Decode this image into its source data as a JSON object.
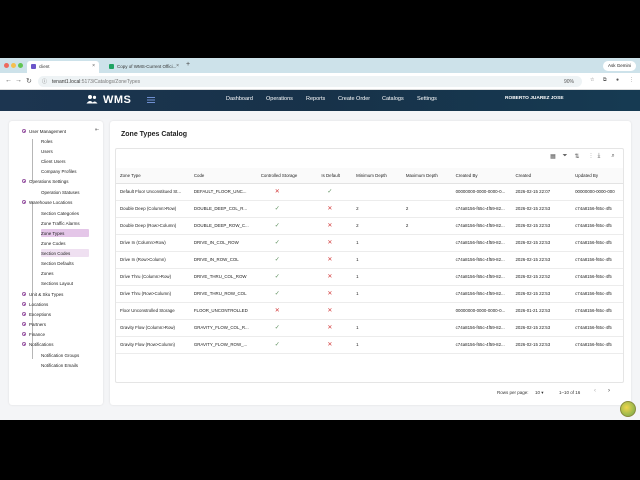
{
  "browser": {
    "tabs": [
      {
        "title": "client",
        "active": true
      },
      {
        "title": "Copy of WMS-Current Offici...",
        "active": false
      }
    ],
    "ask_button": "Ask Gemini",
    "url_host": "tenant1.local",
    "url_path": ":5173/Catalogs/ZoneTypes",
    "zoom": "90%"
  },
  "app": {
    "logo": "WMS",
    "nav": [
      "Dashboard",
      "Operations",
      "Reports",
      "Create Order",
      "Catalogs",
      "Settings"
    ],
    "user": "ROBERTO JUAREZ JOSE"
  },
  "sidebar": {
    "items": [
      {
        "label": "User Management",
        "level": 0
      },
      {
        "label": "Roles",
        "level": 1
      },
      {
        "label": "Users",
        "level": 1
      },
      {
        "label": "Client Users",
        "level": 1
      },
      {
        "label": "Company Profiles",
        "level": 1
      },
      {
        "label": "Operations Settings",
        "level": 0
      },
      {
        "label": "Operation Statuses",
        "level": 1
      },
      {
        "label": "Warehouse Locations",
        "level": 0
      },
      {
        "label": "Section Categories",
        "level": 1
      },
      {
        "label": "Zone Traffic Alarms",
        "level": 1
      },
      {
        "label": "Zone Types",
        "level": 1
      },
      {
        "label": "Zone Codes",
        "level": 1
      },
      {
        "label": "Section Codes",
        "level": 1
      },
      {
        "label": "Section Defaults",
        "level": 1
      },
      {
        "label": "Zones",
        "level": 1
      },
      {
        "label": "Sections Layout",
        "level": 1
      },
      {
        "label": "Unit & Sku Types",
        "level": 0
      },
      {
        "label": "Locations",
        "level": 0
      },
      {
        "label": "Exceptions",
        "level": 0
      },
      {
        "label": "Partners",
        "level": 0
      },
      {
        "label": "Finance",
        "level": 0
      },
      {
        "label": "Notifications",
        "level": 0
      },
      {
        "label": "Notification Groups",
        "level": 1
      },
      {
        "label": "Notification Emails",
        "level": 1
      }
    ]
  },
  "main": {
    "title": "Zone Types Catalog",
    "columns": [
      "Zone Type",
      "Code",
      "Controlled Storage",
      "Is Default",
      "Minimum Depth",
      "Maximum Depth",
      "Created By",
      "Created",
      "Updated By"
    ],
    "rows": [
      [
        "Default Floor Unconstitued St...",
        "DEFAULT_FLOOR_UNC...",
        "no",
        "yes",
        "",
        "",
        "00000000-0000-0000-0...",
        "2026-02-15 22:07",
        "00000000-0000-000"
      ],
      [
        "Double Deep (Column>Row)",
        "DOUBLE_DEEP_COL_R...",
        "yes",
        "no",
        "2",
        "2",
        "c74a8156-f65c-4f59-82...",
        "2026-02-15 22:53",
        "c74a8156-f65c-4f5"
      ],
      [
        "Double Deep (Row>Column)",
        "DOUBLE_DEEP_ROW_C...",
        "yes",
        "no",
        "2",
        "2",
        "c74a8156-f65c-4f59-82...",
        "2026-02-15 22:53",
        "c74a8156-f65c-4f5"
      ],
      [
        "Drive In (Column>Row)",
        "DRIVE_IN_COL_ROW",
        "yes",
        "no",
        "1",
        "",
        "c74a8156-f65c-4f59-82...",
        "2026-02-15 22:53",
        "c74a8156-f65c-4f5"
      ],
      [
        "Drive In (Row>Column)",
        "DRIVE_IN_ROW_COL",
        "yes",
        "no",
        "1",
        "",
        "c74a8156-f65c-4f59-82...",
        "2026-02-15 22:53",
        "c74a8156-f65c-4f5"
      ],
      [
        "Drive Thru (Column>Row)",
        "DRIVE_THRU_COL_ROW",
        "yes",
        "no",
        "1",
        "",
        "c74a8156-f65c-4f59-82...",
        "2026-02-15 22:52",
        "c74a8156-f65c-4f5"
      ],
      [
        "Drive Thru (Row>Column)",
        "DRIVE_THRU_ROW_COL",
        "yes",
        "no",
        "1",
        "",
        "c74a8156-f65c-4f59-82...",
        "2026-02-15 22:53",
        "c74a8156-f65c-4f5"
      ],
      [
        "Floor Unconstrolled Storage",
        "FLOOR_UNCONTROLLED",
        "no",
        "no",
        "",
        "",
        "00000000-0000-0000-0...",
        "2026-01-21 22:53",
        "c74a8156-f65c-4f5"
      ],
      [
        "Gravity Flow (Column>Row)",
        "GRAVITY_FLOW_COL_R...",
        "yes",
        "no",
        "1",
        "",
        "c74a8156-f65c-4f59-82...",
        "2026-02-15 22:53",
        "c74a8156-f65c-4f5"
      ],
      [
        "Gravity Flow (Row>Column)",
        "GRAVITY_FLOW_ROW_...",
        "yes",
        "no",
        "1",
        "",
        "c74a8156-f65c-4f59-82...",
        "2026-02-15 22:53",
        "c74a8156-f65c-4f5"
      ]
    ],
    "pager": {
      "rows_label": "Rows per page:",
      "rows_value": "10",
      "range": "1–10 of 16"
    }
  },
  "colors": {
    "header": "#1c3550",
    "check": "#5c8f5c",
    "cross": "#d23a3a",
    "sidebar_active": "#e4c6e8"
  }
}
